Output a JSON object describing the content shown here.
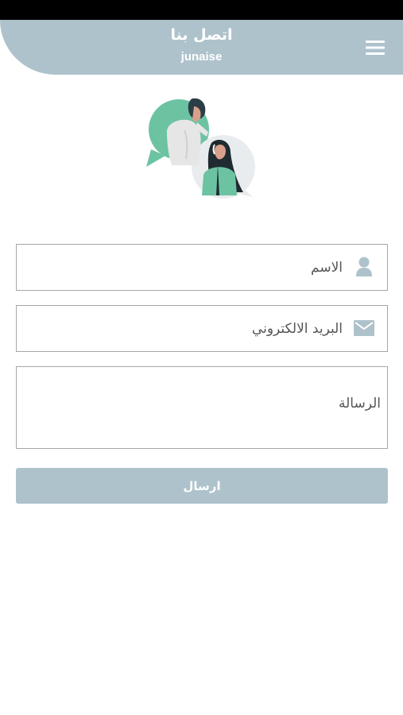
{
  "header": {
    "title": "اتصل بنا",
    "subtitle": "junaise",
    "menu_icon": "hamburger-menu-icon"
  },
  "form": {
    "name_placeholder": "الاسم",
    "name_icon": "user-icon",
    "email_placeholder": "البريد الالكتروني",
    "email_icon": "envelope-icon",
    "message_placeholder": "الرسالة",
    "submit_label": "ارسال"
  },
  "colors": {
    "accent": "#aec2cc",
    "illustration_green": "#6cc3a2",
    "border": "#a6a6a6"
  }
}
